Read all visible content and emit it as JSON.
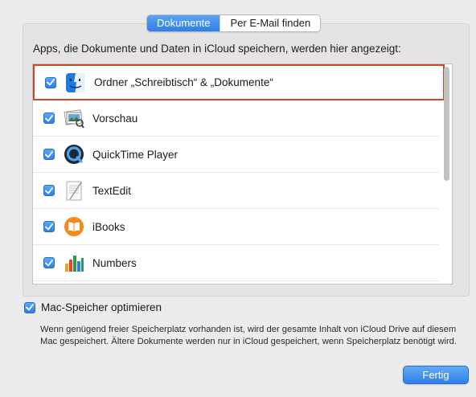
{
  "tabs": [
    {
      "label": "Dokumente",
      "active": true
    },
    {
      "label": "Per E-Mail finden",
      "active": false
    }
  ],
  "panel": {
    "caption": "Apps, die Dokumente und Daten in iCloud speichern, werden hier angezeigt:"
  },
  "apps": [
    {
      "label": "Ordner „Schreibtisch“ & „Dokumente“",
      "icon": "finder-icon",
      "checked": true,
      "selected": true
    },
    {
      "label": "Vorschau",
      "icon": "preview-icon",
      "checked": true
    },
    {
      "label": "QuickTime Player",
      "icon": "quicktime-icon",
      "checked": true
    },
    {
      "label": "TextEdit",
      "icon": "textedit-icon",
      "checked": true
    },
    {
      "label": "iBooks",
      "icon": "ibooks-icon",
      "checked": true
    },
    {
      "label": "Numbers",
      "icon": "numbers-icon",
      "checked": true
    }
  ],
  "optimize": {
    "label": "Mac-Speicher optimieren",
    "checked": true,
    "description": "Wenn genügend freier Speicherplatz vorhanden ist, wird der gesamte Inhalt von iCloud Drive auf diesem Mac gespeichert. Ältere Dokumente werden nur in iCloud gespeichert, wenn Speicherplatz benötigt wird."
  },
  "buttons": {
    "done_label": "Fertig"
  },
  "colors": {
    "accent": "#2e7fe8",
    "selection_border": "#c8472d"
  }
}
